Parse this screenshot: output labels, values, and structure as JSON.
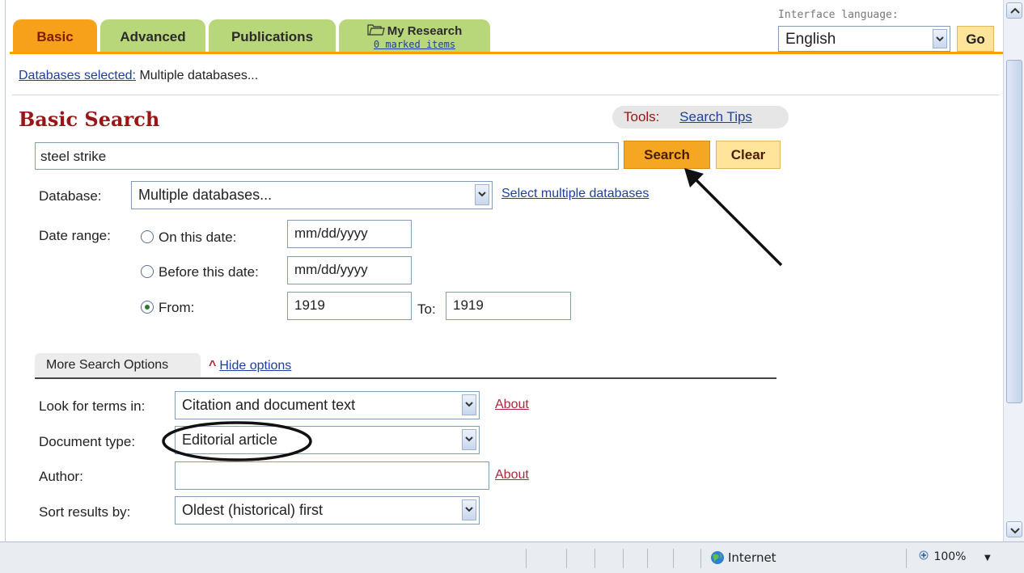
{
  "tabs": [
    {
      "label": "Basic",
      "active": true
    },
    {
      "label": "Advanced"
    },
    {
      "label": "Publications"
    },
    {
      "label": "My Research",
      "sublabel": "0 marked items"
    }
  ],
  "language": {
    "label": "Interface language:",
    "selected": "English",
    "go_label": "Go"
  },
  "databases_selected": {
    "label": "Databases selected:",
    "value": "Multiple databases..."
  },
  "page_title": "Basic Search",
  "tools": {
    "label": "Tools:",
    "search_tips": "Search Tips"
  },
  "search": {
    "query": "steel strike",
    "search_label": "Search",
    "clear_label": "Clear"
  },
  "database": {
    "label": "Database:",
    "selected": "Multiple databases...",
    "select_multiple_link": "Select multiple databases"
  },
  "date_range": {
    "label": "Date range:",
    "on_label": "On this date:",
    "on_value": "mm/dd/yyyy",
    "before_label": "Before this date:",
    "before_value": "mm/dd/yyyy",
    "from_label": "From:",
    "from_value": "1919",
    "to_label": "To:",
    "to_value": "1919",
    "selected": "from"
  },
  "more_options": {
    "tab_label": "More Search Options",
    "hide_link": "Hide options",
    "look_for_label": "Look for terms in:",
    "look_for_value": "Citation and document text",
    "doc_type_label": "Document type:",
    "doc_type_value": "Editorial article",
    "author_label": "Author:",
    "author_value": "",
    "about_label": "About",
    "sort_label": "Sort results by:",
    "sort_value": "Oldest (historical) first"
  },
  "statusbar": {
    "zone": "Internet",
    "zoom": "100%"
  },
  "colors": {
    "active_tab": "#f7a11a",
    "inactive_tab": "#b8d67a",
    "title": "#9a1515",
    "link": "#1f3f9f"
  }
}
